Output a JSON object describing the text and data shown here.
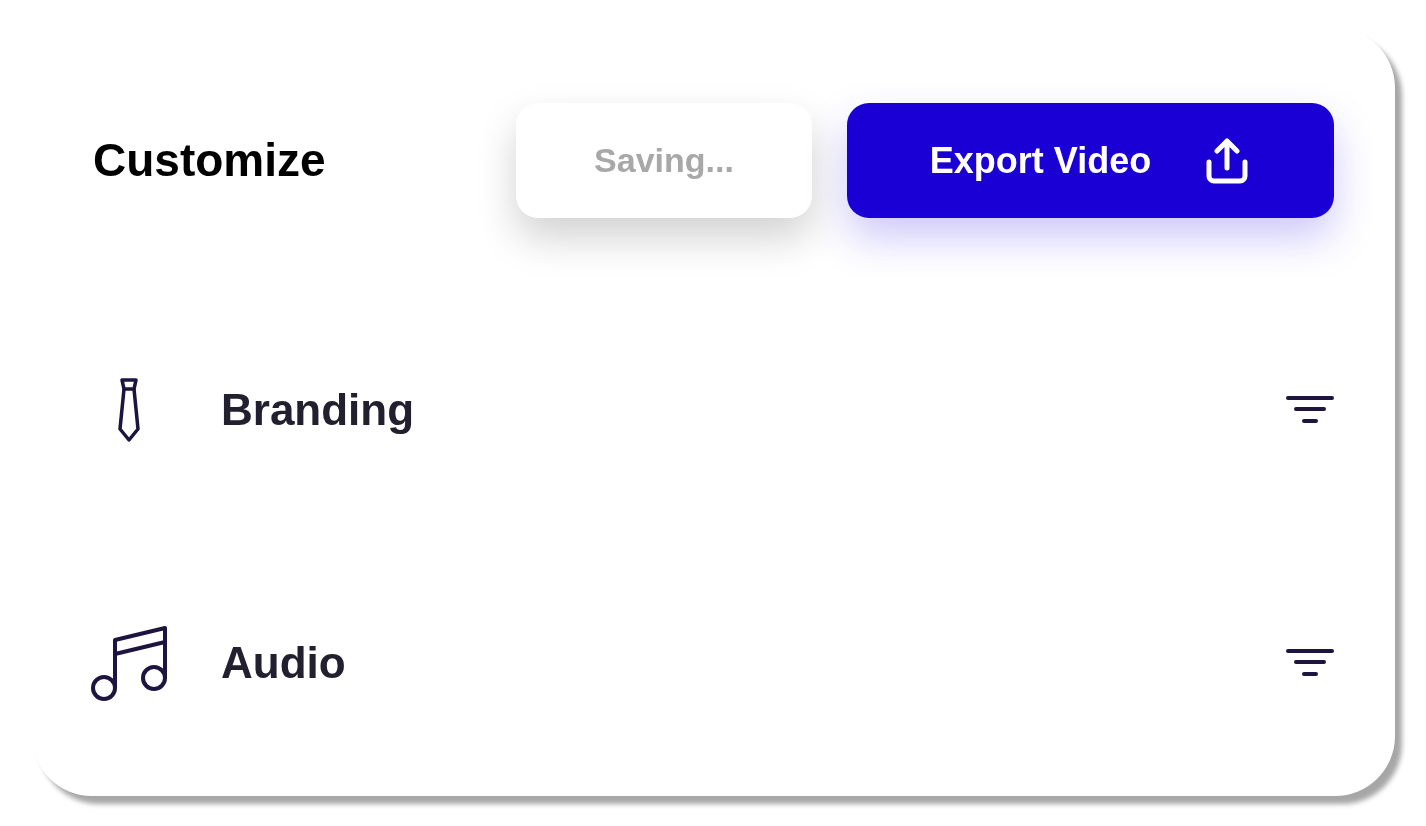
{
  "header": {
    "title": "Customize"
  },
  "buttons": [
    {
      "kind": "status",
      "label": "Saving...",
      "disabled": true
    },
    {
      "kind": "primary",
      "label": "Export Video"
    }
  ],
  "sections": [
    {
      "kind": "tie",
      "label": "Branding"
    },
    {
      "kind": "music",
      "label": "Audio"
    }
  ]
}
